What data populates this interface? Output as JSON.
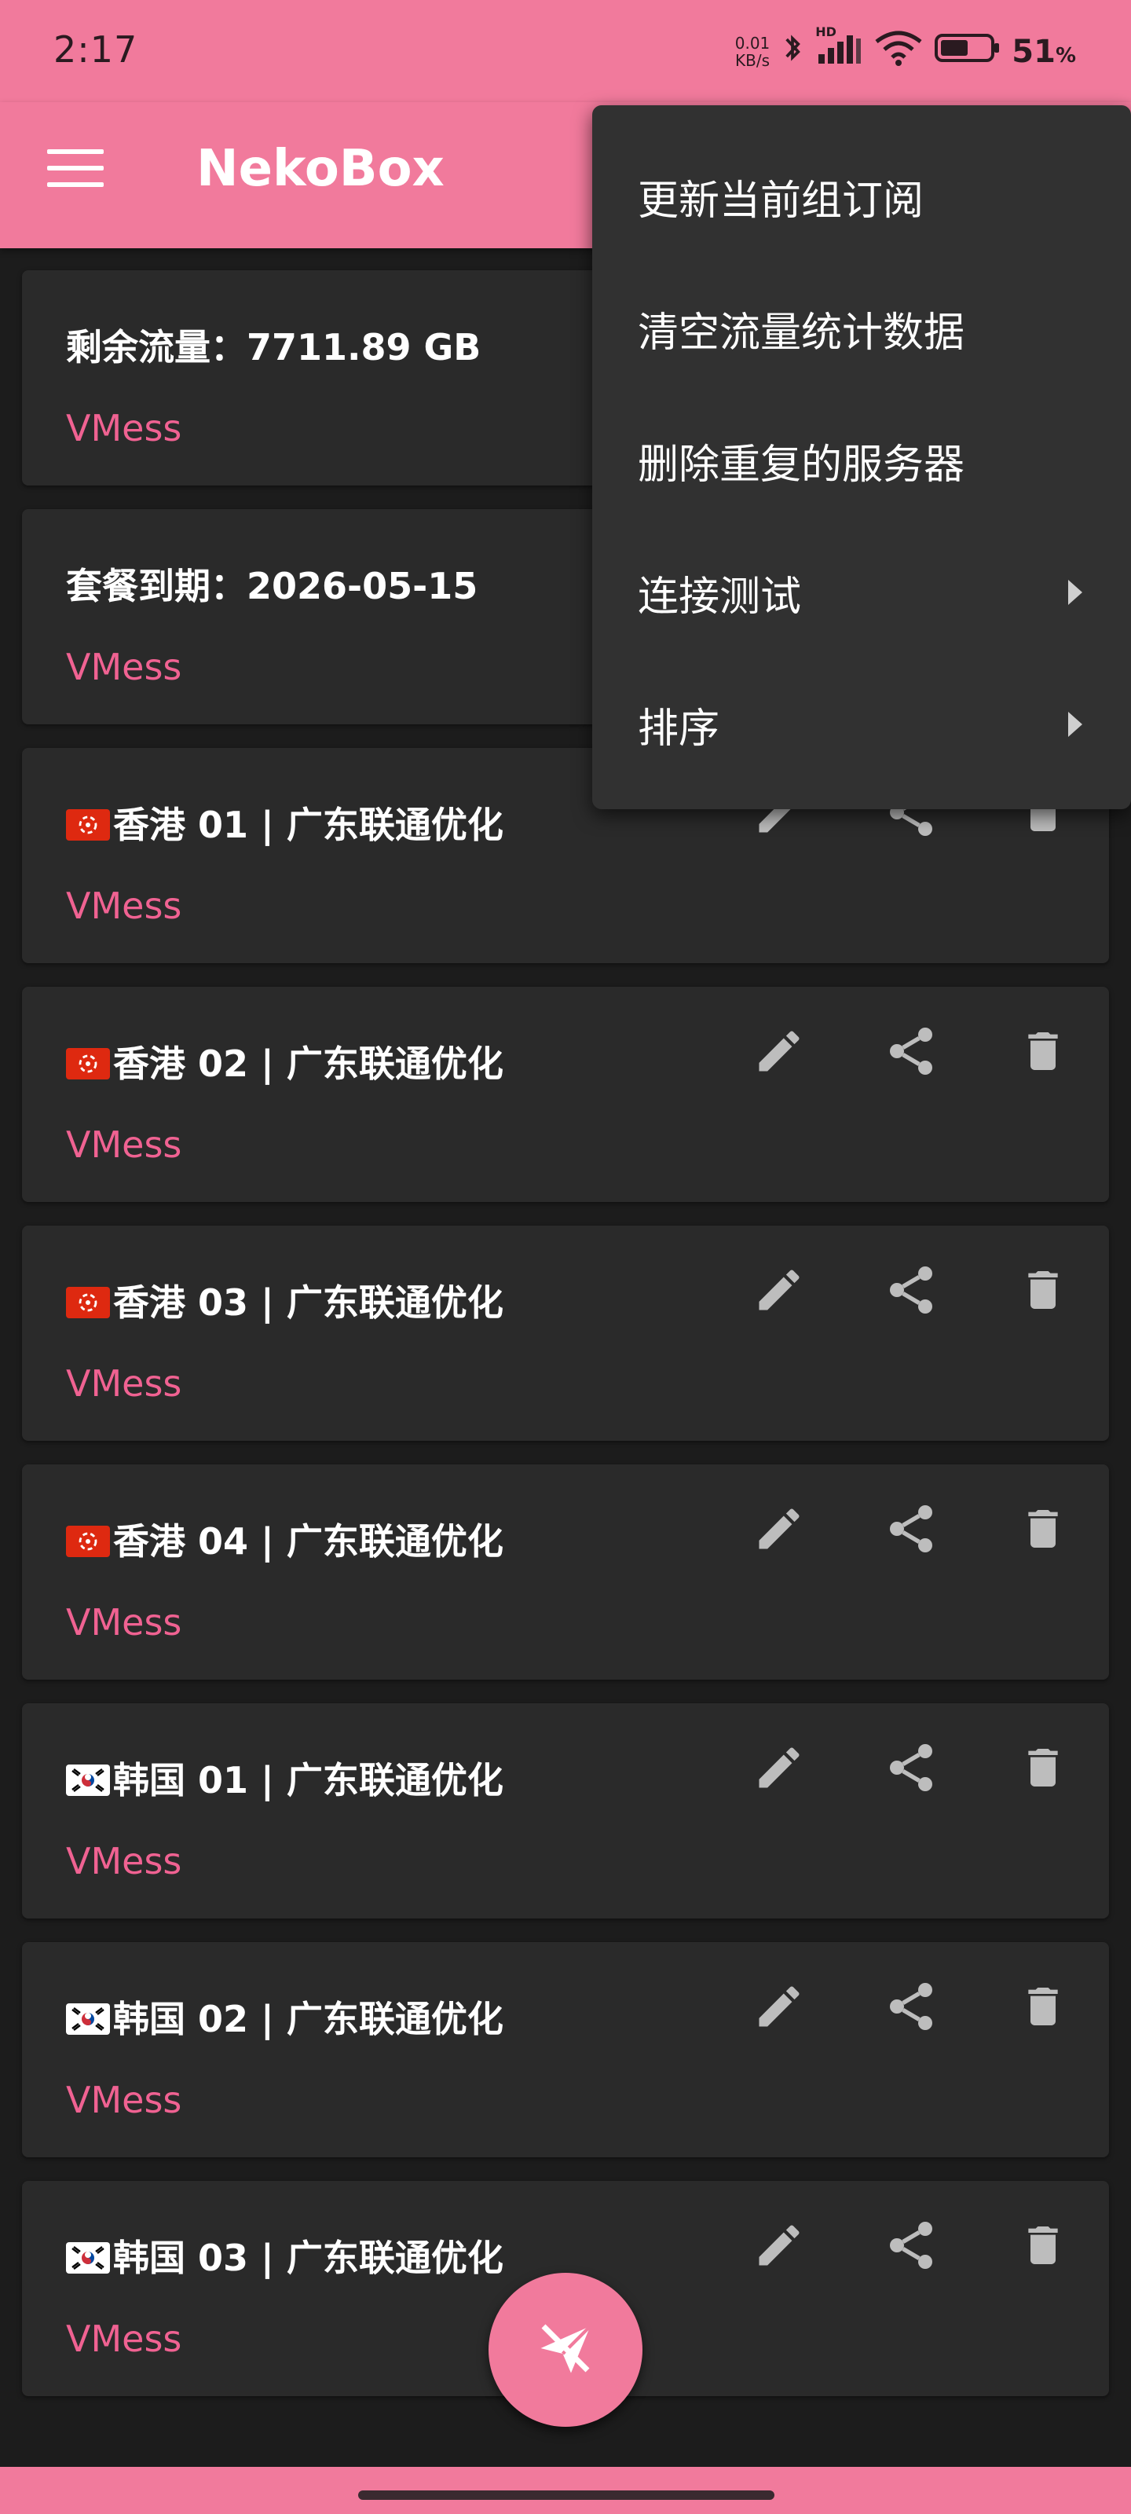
{
  "status_bar": {
    "time": "2:17",
    "net_speed_value": "0.01",
    "net_speed_unit": "KB/s",
    "hd_label": "HD",
    "battery": "51",
    "battery_unit": "%"
  },
  "app_bar": {
    "title": "NekoBox"
  },
  "menu": {
    "items": [
      {
        "label": "更新当前组订阅"
      },
      {
        "label": "清空流量统计数据"
      },
      {
        "label": "删除重复的服务器"
      },
      {
        "label": "连接测试",
        "has_submenu": true
      },
      {
        "label": "排序",
        "has_submenu": true
      }
    ]
  },
  "servers": [
    {
      "name": "剩余流量：7711.89 GB",
      "flag": "",
      "type": "VMess"
    },
    {
      "name": "套餐到期：2026-05-15",
      "flag": "",
      "type": "VMess"
    },
    {
      "name": "香港 01 | 广东联通优化",
      "flag": "hk",
      "type": "VMess"
    },
    {
      "name": "香港 02 | 广东联通优化",
      "flag": "hk",
      "type": "VMess"
    },
    {
      "name": "香港 03 | 广东联通优化",
      "flag": "hk",
      "type": "VMess"
    },
    {
      "name": "香港 04 | 广东联通优化",
      "flag": "hk",
      "type": "VMess"
    },
    {
      "name": "韩国 01 | 广东联通优化",
      "flag": "kr",
      "type": "VMess"
    },
    {
      "name": "韩国 02 | 广东联通优化",
      "flag": "kr",
      "type": "VMess"
    },
    {
      "name": "韩国 03 | 广东联通优化",
      "flag": "kr",
      "type": "VMess"
    }
  ],
  "colors": {
    "accent": "#f17a9c",
    "type_text": "#f06292",
    "card_bg": "#2a2a2a",
    "background": "#1c1c1c",
    "menu_bg": "#313131",
    "icon_grey": "#bdbdbd"
  },
  "icons": {
    "menu": "hamburger-icon",
    "edit": "pencil-icon",
    "share": "share-icon",
    "delete": "trash-icon",
    "fab": "paper-plane-icon",
    "bluetooth": "bluetooth-icon",
    "signal": "signal-icon",
    "wifi": "wifi-icon",
    "battery": "battery-icon",
    "submenu": "chevron-right-icon"
  }
}
